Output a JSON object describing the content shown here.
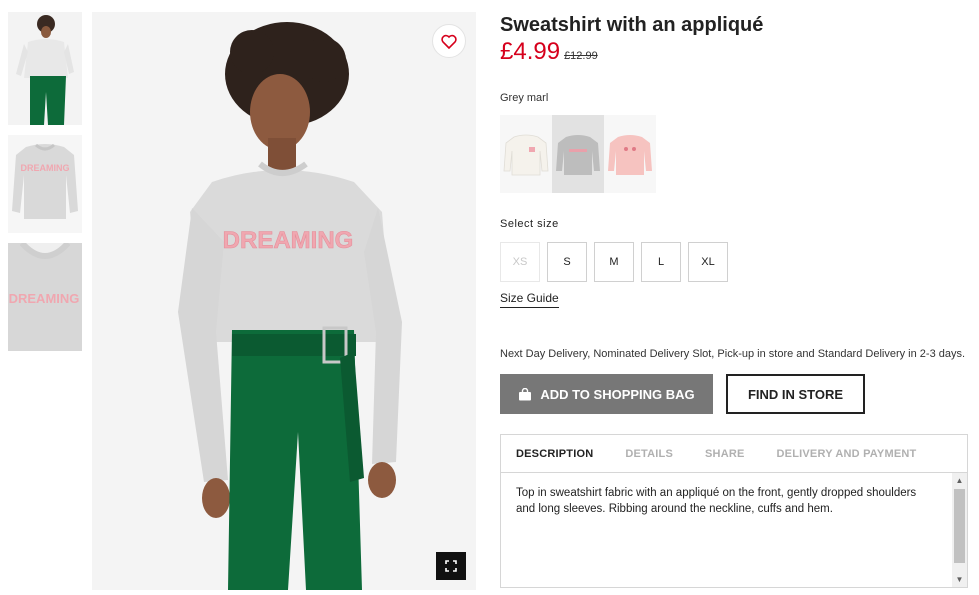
{
  "product": {
    "title": "Sweatshirt with an appliqué",
    "price": "£4.99",
    "old_price": "£12.99",
    "color_name": "Grey marl"
  },
  "gallery": {
    "main_print": "DREAMING",
    "thumb_print_2": "DREAMING",
    "thumb_print_3": "DREAMING"
  },
  "sizes": {
    "label": "Select size",
    "options": [
      "XS",
      "S",
      "M",
      "L",
      "XL"
    ],
    "guide_label": "Size Guide"
  },
  "delivery_text": "Next Day Delivery, Nominated Delivery Slot, Pick-up in store and Standard Delivery in 2-3 days.",
  "actions": {
    "add_to_bag": "ADD TO SHOPPING BAG",
    "find_in_store": "FIND IN STORE"
  },
  "tabs": [
    "DESCRIPTION",
    "DETAILS",
    "SHARE",
    "DELIVERY AND PAYMENT"
  ],
  "description": "Top in sweatshirt fabric with an appliqué on the front, gently dropped shoulders and long sleeves. Ribbing around the neckline, cuffs and hem.",
  "colors": {
    "price_red": "#d6001c",
    "button_grey": "#777777",
    "print_pink": "#f0a7b0",
    "trousers_green": "#0d6b3a"
  }
}
